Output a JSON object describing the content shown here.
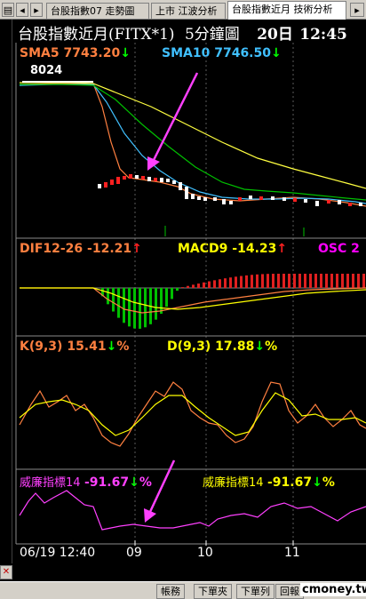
{
  "tabs": [
    {
      "label": "台股指數07 走勢圖",
      "active": false
    },
    {
      "label": "上市 江波分析",
      "active": false
    },
    {
      "label": "台股指數近月 技術分析",
      "active": true
    }
  ],
  "title": {
    "name": "台股指數近月(FITX*1)",
    "interval": "5分鐘圖",
    "day": "20日",
    "time": "12:45"
  },
  "sma": {
    "sma5_label": "SMA5",
    "sma5_value": "7743.20",
    "sma10_label": "SMA10",
    "sma10_value": "7746.50",
    "high_label": "8024"
  },
  "macd": {
    "dif_label": "DIF12-26",
    "dif_value": "-12.21",
    "macd_label": "MACD9",
    "macd_value": "-14.23",
    "osc_label": "OSC",
    "osc_value": "2"
  },
  "kd": {
    "k_label": "K(9,3)",
    "k_value": "15.41",
    "d_label": "D(9,3)",
    "d_value": "17.88",
    "pct": "%"
  },
  "wr": {
    "left_label": "威廉指標14",
    "left_value": "-91.67",
    "right_label": "威廉指標14",
    "right_value": "-91.67",
    "pct": "%"
  },
  "xaxis": {
    "start": "06/19 12:40",
    "ticks": [
      "09",
      "10",
      "11"
    ]
  },
  "bottom_buttons": [
    "帳務",
    "下單夾",
    "下單列",
    "回報"
  ],
  "watermark": "cmoney.tw",
  "colors": {
    "sma5": "#ff8040",
    "sma10": "#40c0ff",
    "kline_up": "#ff2020",
    "kline_down": "#ffffff",
    "dif": "#ff8040",
    "macd": "#ffff00",
    "osc": "#ff00ff",
    "arrow_pointer": "#ff40ff",
    "up_arrow": "#ff2020",
    "down_arrow": "#00ff00"
  }
}
